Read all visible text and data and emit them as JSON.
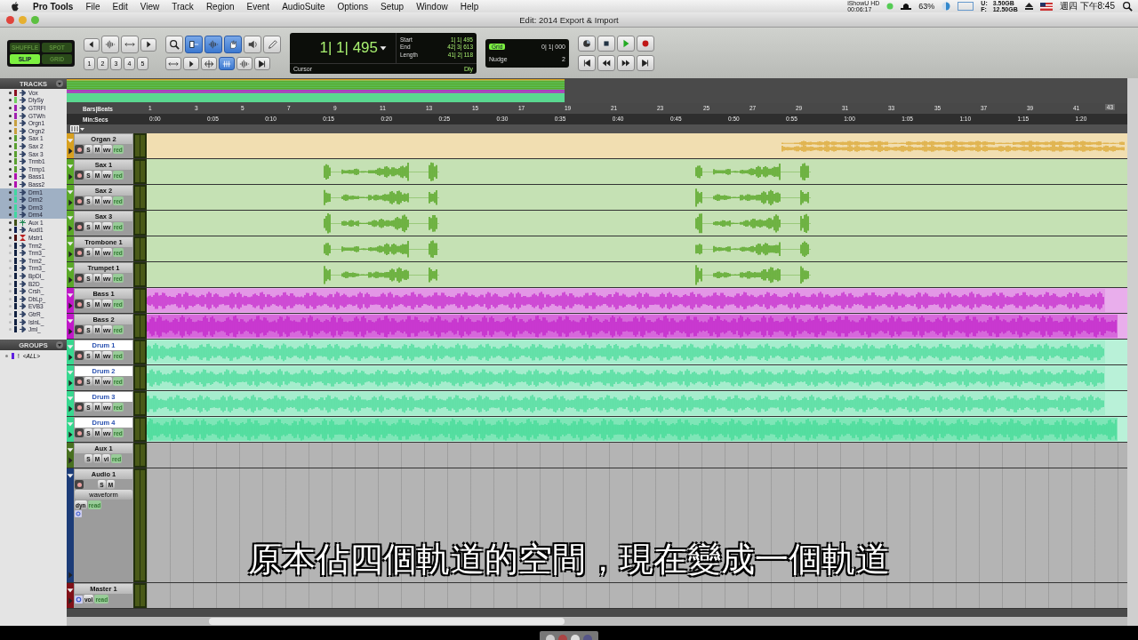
{
  "menu_bar": {
    "app": "Pro Tools",
    "menus": [
      "File",
      "Edit",
      "View",
      "Track",
      "Region",
      "Event",
      "AudioSuite",
      "Options",
      "Setup",
      "Window",
      "Help"
    ],
    "recorder": "iShowU HD",
    "recorder_time": "00:06:17",
    "battery": "63%",
    "disk_u_label": "U:",
    "disk_u": "3.50GB",
    "disk_f_label": "F:",
    "disk_f": "12.50GB",
    "clock": "週四 下午8:45"
  },
  "window": {
    "title": "Edit: 2014 Export & Import"
  },
  "toolbar": {
    "edit_modes": [
      {
        "label": "SHUFFLE",
        "selected": false
      },
      {
        "label": "SPOT",
        "selected": false
      },
      {
        "label": "SLIP",
        "selected": true
      },
      {
        "label": "GRID",
        "selected": false
      }
    ],
    "zoom_presets": [
      "1",
      "2",
      "3",
      "4",
      "5"
    ],
    "counter": {
      "main": "1| 1| 495",
      "start_label": "Start",
      "start": "1| 1| 495",
      "end_label": "End",
      "end": "42| 3| 613",
      "length_label": "Length",
      "length": "41| 2| 118",
      "cursor_label": "Cursor",
      "delay": "Dly"
    },
    "grid": {
      "label": "Grid",
      "value": "0| 1| 000",
      "nudge_label": "Nudge",
      "nudge": "2"
    }
  },
  "tracks_list": {
    "header": "TRACKS",
    "items": [
      {
        "name": "Vox",
        "color": "#8a1020",
        "shown": true,
        "selected": false,
        "kind": "audio"
      },
      {
        "name": "DlySy",
        "color": "#70d060",
        "shown": true,
        "selected": false,
        "kind": "audio"
      },
      {
        "name": "GTRFl",
        "color": "#a020b0",
        "shown": true,
        "selected": false,
        "kind": "audio"
      },
      {
        "name": "GTWh",
        "color": "#a020b0",
        "shown": true,
        "selected": false,
        "kind": "audio"
      },
      {
        "name": "Orgn1",
        "color": "#c8a040",
        "shown": true,
        "selected": false,
        "kind": "audio"
      },
      {
        "name": "Orgn2",
        "color": "#c8a040",
        "shown": true,
        "selected": false,
        "kind": "audio"
      },
      {
        "name": "Sax 1",
        "color": "#5aa030",
        "shown": true,
        "selected": false,
        "kind": "audio"
      },
      {
        "name": "Sax 2",
        "color": "#5aa030",
        "shown": true,
        "selected": false,
        "kind": "audio"
      },
      {
        "name": "Sax 3",
        "color": "#5aa030",
        "shown": true,
        "selected": false,
        "kind": "audio"
      },
      {
        "name": "Trmb1",
        "color": "#5aa030",
        "shown": true,
        "selected": false,
        "kind": "audio"
      },
      {
        "name": "Trmp1",
        "color": "#5aa030",
        "shown": true,
        "selected": false,
        "kind": "audio"
      },
      {
        "name": "Bass1",
        "color": "#b010b0",
        "shown": true,
        "selected": false,
        "kind": "audio"
      },
      {
        "name": "Bass2",
        "color": "#b010b0",
        "shown": true,
        "selected": false,
        "kind": "audio"
      },
      {
        "name": "Drm1",
        "color": "#40d8a0",
        "shown": true,
        "selected": true,
        "kind": "audio"
      },
      {
        "name": "Drm2",
        "color": "#40d8a0",
        "shown": true,
        "selected": true,
        "kind": "audio"
      },
      {
        "name": "Drm3",
        "color": "#40d8a0",
        "shown": true,
        "selected": true,
        "kind": "audio"
      },
      {
        "name": "Drm4",
        "color": "#40d8a0",
        "shown": true,
        "selected": true,
        "kind": "audio"
      },
      {
        "name": "Aux 1",
        "color": "#405018",
        "shown": true,
        "selected": false,
        "kind": "aux"
      },
      {
        "name": "Audi1",
        "color": "#102050",
        "shown": true,
        "selected": false,
        "kind": "audio"
      },
      {
        "name": "Mstr1",
        "color": "#501010",
        "shown": true,
        "selected": false,
        "kind": "master"
      },
      {
        "name": "Trm2_",
        "color": "#102040",
        "shown": false,
        "selected": false,
        "kind": "audio"
      },
      {
        "name": "Trm3_",
        "color": "#102040",
        "shown": false,
        "selected": false,
        "kind": "audio"
      },
      {
        "name": "Trm2_",
        "color": "#102040",
        "shown": false,
        "selected": false,
        "kind": "audio"
      },
      {
        "name": "Trm3_",
        "color": "#102040",
        "shown": false,
        "selected": false,
        "kind": "audio"
      },
      {
        "name": "BpDl_",
        "color": "#102040",
        "shown": false,
        "selected": false,
        "kind": "audio"
      },
      {
        "name": "B2D_",
        "color": "#102040",
        "shown": false,
        "selected": false,
        "kind": "audio"
      },
      {
        "name": "Crsh_",
        "color": "#102040",
        "shown": false,
        "selected": false,
        "kind": "audio"
      },
      {
        "name": "DbLp_",
        "color": "#102040",
        "shown": false,
        "selected": false,
        "kind": "audio"
      },
      {
        "name": "EVB3",
        "color": "#102040",
        "shown": false,
        "selected": false,
        "kind": "audio"
      },
      {
        "name": "GtrR_",
        "color": "#102040",
        "shown": false,
        "selected": false,
        "kind": "audio"
      },
      {
        "name": "IslnL_",
        "color": "#102040",
        "shown": false,
        "selected": false,
        "kind": "audio"
      },
      {
        "name": "Jml_",
        "color": "#102040",
        "shown": false,
        "selected": false,
        "kind": "audio"
      }
    ]
  },
  "groups": {
    "header": "GROUPS",
    "items": [
      {
        "id": "!",
        "name": "<ALL>",
        "color": "#6020e0"
      }
    ]
  },
  "ruler": {
    "bars_label": "Bars|Beats",
    "minsecs_label": "Min:Secs",
    "bars": [
      "1",
      "3",
      "5",
      "7",
      "9",
      "11",
      "13",
      "15",
      "17",
      "19",
      "21",
      "23",
      "25",
      "27",
      "29",
      "31",
      "33",
      "35",
      "37",
      "39",
      "41"
    ],
    "end_bar": "43",
    "minsecs": [
      "0:00",
      "0:05",
      "0:10",
      "0:15",
      "0:20",
      "0:25",
      "0:30",
      "0:35",
      "0:40",
      "0:45",
      "0:50",
      "0:55",
      "1:00",
      "1:05",
      "1:10",
      "1:15",
      "1:20"
    ]
  },
  "tracks": [
    {
      "name": "Organ 2",
      "color": "#d8a020",
      "kind": "audio",
      "selected": false,
      "region": {
        "kind": "pad"
      },
      "buttons": [
        "S",
        "M",
        "wv",
        "red"
      ]
    },
    {
      "name": "Sax 1",
      "color": "#5aa828",
      "kind": "audio",
      "selected": false,
      "region": {
        "kind": "horns"
      },
      "buttons": [
        "S",
        "M",
        "wv",
        "red"
      ]
    },
    {
      "name": "Sax 2",
      "color": "#5aa828",
      "kind": "audio",
      "selected": false,
      "region": {
        "kind": "horns"
      },
      "buttons": [
        "S",
        "M",
        "wv",
        "red"
      ]
    },
    {
      "name": "Sax 3",
      "color": "#5aa828",
      "kind": "audio",
      "selected": false,
      "region": {
        "kind": "horns"
      },
      "buttons": [
        "S",
        "M",
        "wv",
        "red"
      ]
    },
    {
      "name": "Trombone 1",
      "color": "#5aa828",
      "kind": "audio",
      "selected": false,
      "region": {
        "kind": "horns"
      },
      "buttons": [
        "S",
        "M",
        "wv",
        "red"
      ]
    },
    {
      "name": "Trumpet 1",
      "color": "#5aa828",
      "kind": "audio",
      "selected": false,
      "region": {
        "kind": "horns"
      },
      "buttons": [
        "S",
        "M",
        "wv",
        "red"
      ]
    },
    {
      "name": "Bass 1",
      "color": "#c018c8",
      "kind": "audio",
      "selected": false,
      "region": {
        "kind": "dense"
      },
      "buttons": [
        "S",
        "M",
        "wv",
        "red"
      ]
    },
    {
      "name": "Bass 2",
      "color": "#c018c8",
      "kind": "audio",
      "selected": false,
      "region": {
        "kind": "heavy"
      },
      "buttons": [
        "S",
        "M",
        "wv",
        "red"
      ]
    },
    {
      "name": "Drum 1",
      "color": "#38d890",
      "kind": "audio",
      "selected": true,
      "region": {
        "kind": "dense"
      },
      "buttons": [
        "S",
        "M",
        "wv",
        "red"
      ]
    },
    {
      "name": "Drum 2",
      "color": "#38d890",
      "kind": "audio",
      "selected": true,
      "region": {
        "kind": "dense"
      },
      "buttons": [
        "S",
        "M",
        "wv",
        "red"
      ]
    },
    {
      "name": "Drum 3",
      "color": "#38d890",
      "kind": "audio",
      "selected": true,
      "region": {
        "kind": "dense"
      },
      "buttons": [
        "S",
        "M",
        "wv",
        "red"
      ]
    },
    {
      "name": "Drum 4",
      "color": "#38d890",
      "kind": "audio",
      "selected": true,
      "region": {
        "kind": "heavy"
      },
      "buttons": [
        "S",
        "M",
        "wv",
        "red"
      ]
    },
    {
      "name": "Aux 1",
      "color": "#487020",
      "kind": "aux",
      "selected": false,
      "buttons": [
        "S",
        "M",
        "vl",
        "red"
      ]
    },
    {
      "name": "Audio 1",
      "color": "#1c3c78",
      "kind": "expanded",
      "selected": false,
      "buttons": [
        "S",
        "M"
      ],
      "view": "waveform",
      "controls": [
        "dyn",
        "read"
      ]
    },
    {
      "name": "Master 1",
      "color": "#801018",
      "kind": "master",
      "selected": false,
      "buttons": [
        "vol",
        "read"
      ]
    }
  ],
  "subtitle": "原本佔四個軌道的空間，現在變成一個軌道"
}
